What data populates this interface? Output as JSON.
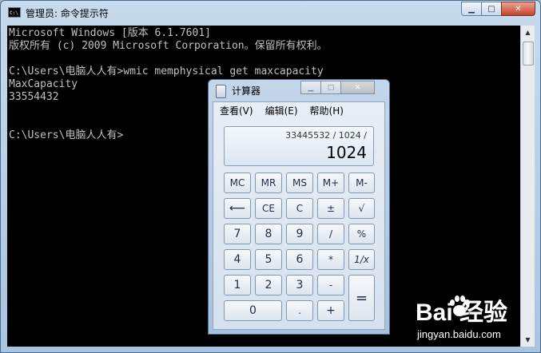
{
  "cmd": {
    "title": "管理员: 命令提示符",
    "icon_text": "C:\\",
    "window_buttons": {
      "minimize": "▁",
      "maximize": "□",
      "close": "✕"
    },
    "lines": [
      "Microsoft Windows [版本 6.1.7601]",
      "版权所有 (c) 2009 Microsoft Corporation。保留所有权利。",
      "",
      "C:\\Users\\电脑人人有>wmic memphysical get maxcapacity",
      "MaxCapacity",
      "33554432",
      "",
      "",
      "C:\\Users\\电脑人人有>"
    ]
  },
  "calc": {
    "title": "计算器",
    "window_buttons": {
      "minimize": "▁",
      "maximize": "□",
      "close": "✕"
    },
    "menu": [
      "查看(V)",
      "编辑(E)",
      "帮助(H)"
    ],
    "display": {
      "expression": "33445532 / 1024 /",
      "value": "1024"
    },
    "keys": {
      "mc": "MC",
      "mr": "MR",
      "ms": "MS",
      "mplus": "M+",
      "mminus": "M-",
      "backspace": "⟵",
      "ce": "CE",
      "c": "C",
      "plusminus": "±",
      "sqrt": "√",
      "n7": "7",
      "n8": "8",
      "n9": "9",
      "divide": "/",
      "percent": "%",
      "n4": "4",
      "n5": "5",
      "n6": "6",
      "multiply": "*",
      "reciprocal": "1/x",
      "n1": "1",
      "n2": "2",
      "n3": "3",
      "minus": "-",
      "equals": "=",
      "n0": "0",
      "dot": ".",
      "plus": "+"
    }
  },
  "watermark": {
    "logo": "Bai  经验",
    "url": "jingyan.baidu.com"
  }
}
